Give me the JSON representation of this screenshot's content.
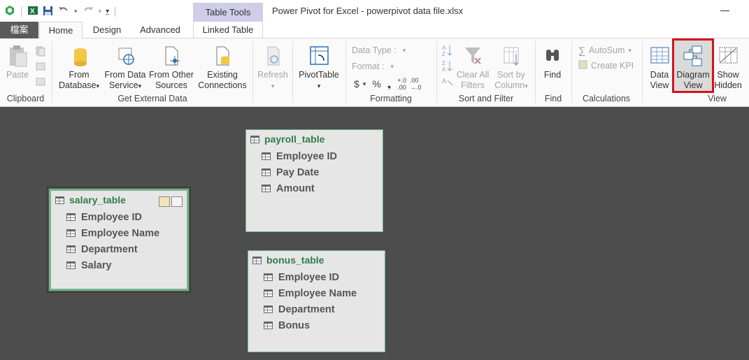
{
  "window": {
    "title": "Power Pivot for Excel - powerpivot data file.xlsx",
    "context_group": "Table Tools"
  },
  "tabs": [
    {
      "label": "檔案"
    },
    {
      "label": "Home"
    },
    {
      "label": "Design"
    },
    {
      "label": "Advanced"
    },
    {
      "label": "Linked Table"
    }
  ],
  "ribbon": {
    "clipboard": {
      "paste": "Paste",
      "group": "Clipboard"
    },
    "get_external": {
      "from_database": [
        "From",
        "Database"
      ],
      "from_data_service": [
        "From Data",
        "Service"
      ],
      "from_other": [
        "From Other",
        "Sources"
      ],
      "existing": [
        "Existing",
        "Connections"
      ],
      "group": "Get External Data"
    },
    "refresh": "Refresh",
    "pivottable": "PivotTable",
    "formatting": {
      "data_type": "Data Type :",
      "format": "Format :",
      "currency": "$",
      "percent": "%",
      "comma": "❟",
      "group": "Formatting"
    },
    "sort_filter": {
      "clear": [
        "Clear All",
        "Filters"
      ],
      "sort_by": [
        "Sort by",
        "Column"
      ],
      "group": "Sort and Filter"
    },
    "find": {
      "label": "Find",
      "group": "Find"
    },
    "calculations": {
      "autosum": "AutoSum",
      "create_kpi": "Create KPI",
      "group": "Calculations"
    },
    "view": {
      "data_view": [
        "Data",
        "View"
      ],
      "diagram_view": [
        "Diagram",
        "View"
      ],
      "show_hidden": [
        "Show",
        "Hidden"
      ],
      "group": "View"
    }
  },
  "diagram": {
    "salary_table": {
      "name": "salary_table",
      "columns": [
        "Employee ID",
        "Employee Name",
        "Department",
        "Salary"
      ]
    },
    "payroll_table": {
      "name": "payroll_table",
      "columns": [
        "Employee ID",
        "Pay Date",
        "Amount"
      ]
    },
    "bonus_table": {
      "name": "bonus_table",
      "columns": [
        "Employee ID",
        "Employee Name",
        "Department",
        "Bonus"
      ]
    }
  },
  "colors": {
    "highlight": "#d3131e",
    "table_name": "#2f7d4a",
    "canvas": "#4d4d4d"
  }
}
